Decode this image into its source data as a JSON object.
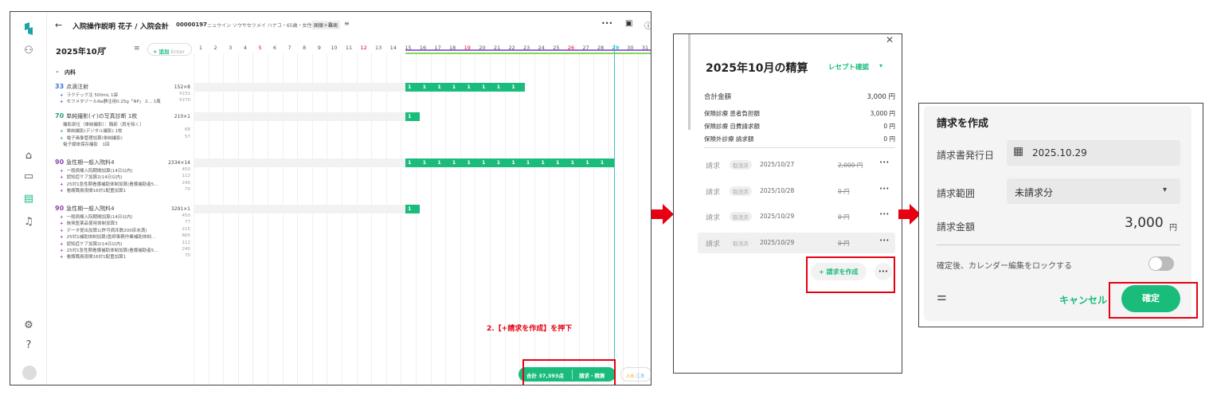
{
  "panel1": {
    "title": "入院操作説明 花子 / 入院会計",
    "patient_id": "00000197",
    "patient_info": "・ニュウイン ソウサセツメイ ハナコ・65歳・女性",
    "insurance_badge": "国保＋難病",
    "month": "2025年10月",
    "add_label": "追加",
    "add_hint": "Enter",
    "dept": "内科",
    "days": [
      "1",
      "2",
      "3",
      "4",
      "5",
      "6",
      "7",
      "8",
      "9",
      "10",
      "11",
      "12",
      "13",
      "14",
      "15",
      "16",
      "17",
      "18",
      "19",
      "20",
      "21",
      "22",
      "23",
      "24",
      "25",
      "26",
      "27",
      "28",
      "29",
      "30",
      "31"
    ],
    "weekend_red_days": [
      "5",
      "12",
      "19",
      "26"
    ],
    "items": [
      {
        "num": "33",
        "name": "点滴注射",
        "qty": "152×8",
        "subs": [
          {
            "mark": "+",
            "text": "ラクテック注 500mL 1袋",
            "val": "¥231"
          },
          {
            "mark": "+",
            "text": "セフメタゾールNa静注用0.25g「NP」 2… 1瓶",
            "val": "¥270"
          }
        ]
      },
      {
        "num": "70",
        "name": "単純撮影(イ)の写真診断 1枚",
        "qty": "210×1",
        "subs": [
          {
            "mark": "",
            "text": "撮影部位（単純撮影）：胸部（肩を除く）",
            "val": ""
          },
          {
            "mark": "+",
            "text": "単純撮影(デジタル撮影) 1枚",
            "val": "68"
          },
          {
            "mark": "+",
            "text": "電子画像管理加算(単純撮影)",
            "val": "57"
          },
          {
            "mark": "",
            "text": "電子媒体保存撮影　1回",
            "val": ""
          }
        ]
      },
      {
        "num": "90",
        "name": "急性期一般入院料4",
        "qty": "2334×14",
        "subs": [
          {
            "mark": "+",
            "text": "一般病棟入院期間加算(14日以内)",
            "val": "450"
          },
          {
            "mark": "+",
            "text": "認知症ケア加算2(14日以内)",
            "val": "112"
          },
          {
            "mark": "+",
            "text": "25対1急性期看護補助体制加算(看護補助者5…",
            "val": "240"
          },
          {
            "mark": "+",
            "text": "看護職員夜間16対1配置加算1",
            "val": "70"
          }
        ]
      },
      {
        "num": "90",
        "name": "急性期一般入院料4",
        "qty": "3291×1",
        "subs": [
          {
            "mark": "+",
            "text": "一般病棟入院期間加算(14日以内)",
            "val": "450"
          },
          {
            "mark": "+",
            "text": "後発医薬品使用体制加算3",
            "val": "77"
          },
          {
            "mark": "+",
            "text": "データ提出加算1(許可病床数200床未満)",
            "val": "215"
          },
          {
            "mark": "+",
            "text": "25対1補助体制加算(医師事務作業補助体制…",
            "val": "665"
          },
          {
            "mark": "+",
            "text": "認知症ケア加算2(14日以内)",
            "val": "112"
          },
          {
            "mark": "+",
            "text": "25対1急性期看護補助体制加算(看護補助者5…",
            "val": "240"
          },
          {
            "mark": "+",
            "text": "看護職員夜間16対1配置加算1",
            "val": "70"
          }
        ]
      }
    ],
    "bar_cells": [
      "1",
      "1",
      "1",
      "1",
      "1",
      "1",
      "1",
      "1",
      "1",
      "1",
      "1",
      "1",
      "1",
      "1"
    ],
    "instruction": "2.【+請求を作成】を押下",
    "total": "合計 37,393点",
    "settle": "請求・精算",
    "alert_text": "6",
    "info_text": "3"
  },
  "panel2": {
    "title": "2025年10月の精算",
    "receipt": "レセプト確認",
    "lines": [
      {
        "label": "合計金額",
        "value": "3,000 円"
      },
      {
        "label": "保険診療 患者負担額",
        "value": "3,000 円"
      },
      {
        "label": "保険診療 自費請求額",
        "value": "0 円"
      },
      {
        "label": "保険外診療 請求額",
        "value": "0 円"
      }
    ],
    "bills": [
      {
        "label": "請求",
        "tag": "取消済",
        "date": "2025/10/27",
        "amount": "2,000 円"
      },
      {
        "label": "請求",
        "tag": "取消済",
        "date": "2025/10/28",
        "amount": "0 円"
      },
      {
        "label": "請求",
        "tag": "取消済",
        "date": "2025/10/29",
        "amount": "0 円"
      },
      {
        "label": "請求",
        "tag": "取消済",
        "date": "2025/10/29",
        "amount": "0 円"
      }
    ],
    "create_label": "請求を作成",
    "more": "•••"
  },
  "panel3": {
    "title": "請求を作成",
    "issue_label": "請求書発行日",
    "issue_value": "2025.10.29",
    "range_label": "請求範囲",
    "range_value": "未請求分",
    "amount_label": "請求金額",
    "amount_value": "3,000",
    "amount_unit": "円",
    "lock_label": "確定後、カレンダー編集をロックする",
    "cancel": "キャンセル",
    "confirm": "確定"
  },
  "colors": {
    "accent": "#1abc7c",
    "highlight": "#e60012",
    "today_line": "#3cc0c7"
  }
}
